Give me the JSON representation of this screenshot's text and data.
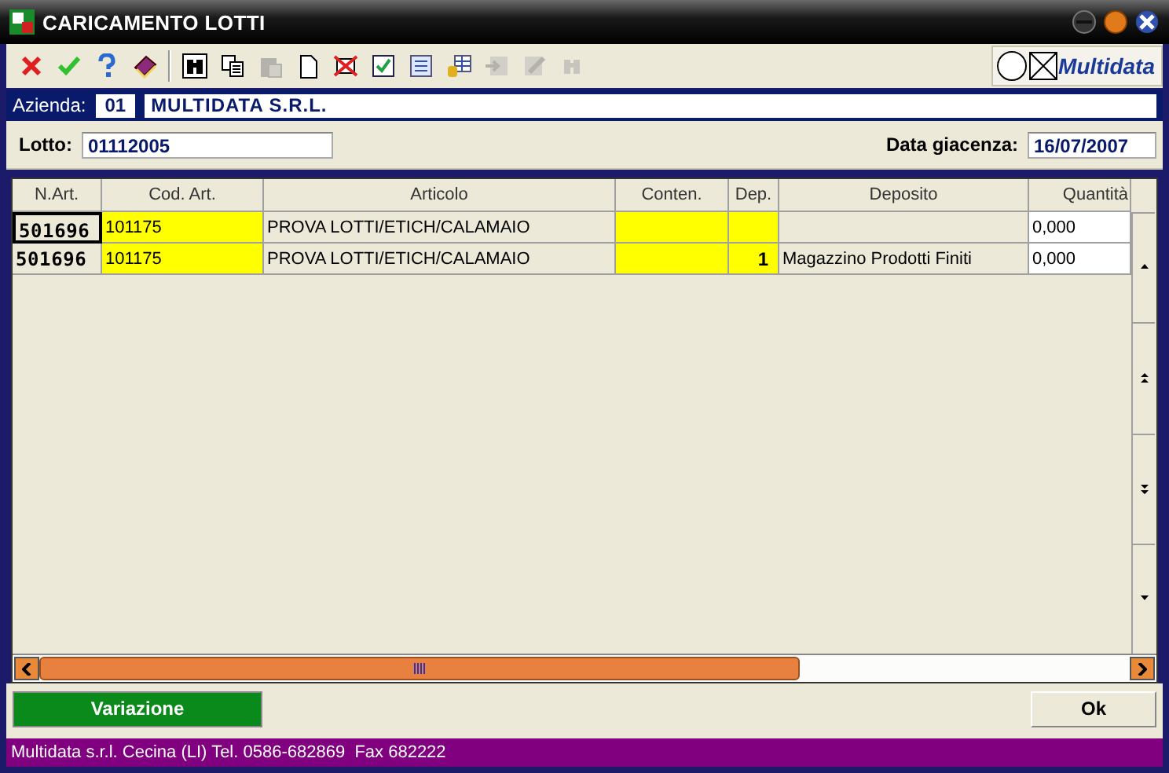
{
  "window": {
    "title": "CARICAMENTO LOTTI"
  },
  "toolbar": [
    {
      "kind": "cancel",
      "disabled": false
    },
    {
      "kind": "confirm",
      "disabled": false
    },
    {
      "kind": "help",
      "disabled": false
    },
    {
      "kind": "book",
      "disabled": false
    },
    {
      "kind": "separator"
    },
    {
      "kind": "find",
      "disabled": false
    },
    {
      "kind": "copy",
      "disabled": false
    },
    {
      "kind": "paste",
      "disabled": true
    },
    {
      "kind": "new",
      "disabled": false
    },
    {
      "kind": "delete",
      "disabled": false
    },
    {
      "kind": "check",
      "disabled": false
    },
    {
      "kind": "list",
      "disabled": false
    },
    {
      "kind": "table",
      "disabled": false
    },
    {
      "kind": "import",
      "disabled": true
    },
    {
      "kind": "edit",
      "disabled": true
    },
    {
      "kind": "search",
      "disabled": true
    }
  ],
  "brand": "Multidata",
  "company": {
    "label": "Azienda:",
    "code": "01",
    "name": "MULTIDATA S.R.L."
  },
  "lot": {
    "label": "Lotto:",
    "value": "01112005"
  },
  "stock_date": {
    "label": "Data giacenza:",
    "value": "16/07/2007"
  },
  "table": {
    "columns": [
      {
        "label": "N.Art.",
        "kind": "code",
        "highlighted": false
      },
      {
        "label": "Cod. Art.",
        "kind": "text",
        "highlighted": true
      },
      {
        "label": "Articolo",
        "kind": "text",
        "highlighted": false
      },
      {
        "label": "Conten.",
        "kind": "text",
        "highlighted": true
      },
      {
        "label": "Dep.",
        "kind": "number",
        "highlighted": true
      },
      {
        "label": "Deposito",
        "kind": "text",
        "highlighted": false
      },
      {
        "label": "Quantità",
        "kind": "input",
        "highlighted": false
      }
    ],
    "rows": [
      {
        "focused": true,
        "cells": [
          "501696",
          "101175",
          "PROVA LOTTI/ETICH/CALAMAIO",
          "",
          "",
          "",
          "0,000"
        ]
      },
      {
        "focused": false,
        "cells": [
          "501696",
          "101175",
          "PROVA LOTTI/ETICH/CALAMAIO",
          "",
          "1",
          "Magazzino Prodotti Finiti",
          "0,000"
        ]
      }
    ]
  },
  "buttons": [
    {
      "label": "Variazione",
      "kind": "primary"
    },
    {
      "label": "Ok",
      "kind": "default"
    }
  ],
  "status_bar": "Multidata s.r.l. Cecina (LI) Tel. 0586-682869  Fax 682222"
}
